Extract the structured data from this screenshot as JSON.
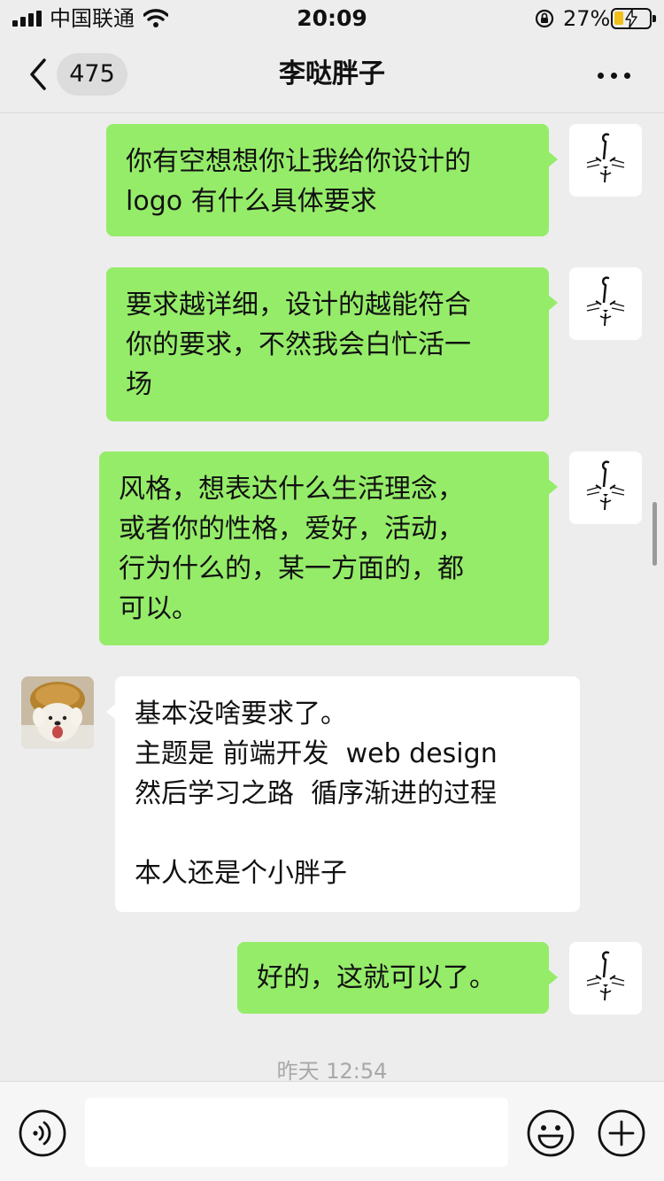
{
  "status_bar": {
    "carrier": "中国联通",
    "time": "20:09",
    "battery_percent": "27%",
    "battery_level": 0.27,
    "signal_bars": 4
  },
  "nav": {
    "back_icon": "chevron-left-icon",
    "unread_count": "475",
    "title": "李哒胖子",
    "more_icon": "ellipsis-icon"
  },
  "messages": [
    {
      "side": "out",
      "text": "你有空想想你让我给你设计的\nlogo 有什么具体要求"
    },
    {
      "side": "out",
      "text": "要求越详细，设计的越能符合\n你的要求，不然我会白忙活一\n场"
    },
    {
      "side": "out",
      "text": "风格，想表达什么生活理念，\n或者你的性格，爱好，活动，\n行为什么的，某一方面的，都\n可以。"
    },
    {
      "side": "in",
      "text": "基本没啥要求了。\n主题是 前端开发  web design\n然后学习之路  循序渐进的过程\n\n本人还是个小胖子"
    },
    {
      "side": "out",
      "text": "好的，这就可以了。"
    }
  ],
  "timestamp": "昨天 12:54",
  "input_bar": {
    "voice_icon": "voice-icon",
    "emoji_icon": "emoji-icon",
    "plus_icon": "plus-icon",
    "input_value": ""
  },
  "colors": {
    "out_bubble": "#95ec69",
    "in_bubble": "#ffffff",
    "background": "#ededed",
    "battery": "#f2c01b"
  }
}
